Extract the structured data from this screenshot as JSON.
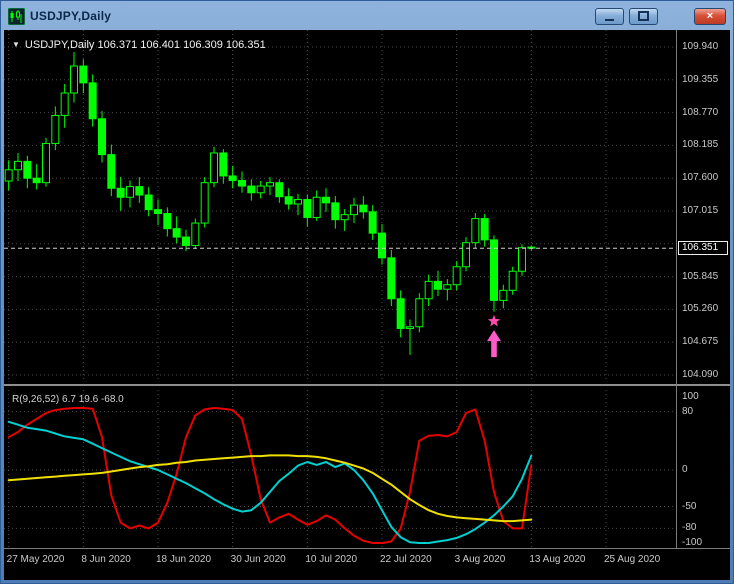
{
  "titlebar": {
    "title": "USDJPY,Daily",
    "close_glyph": "×"
  },
  "main_chart": {
    "marker_glyph": "▼",
    "ohlc_label": "USDJPY,Daily  106.371 106.401 106.309 106.351",
    "current_price": "106.351"
  },
  "indicator_panel": {
    "label": "R(9,26,52) 6.7 19.6 -68.0"
  },
  "colors": {
    "candle": "#00ff00",
    "grid": "#4a4a4a",
    "current_price_line": "#cfcfcf",
    "star": "#ff4dac",
    "arrow": "#ff5bc8",
    "osc_red": "#e60000",
    "osc_cyan": "#00d0d0",
    "osc_yellow": "#f0e000"
  },
  "chart_data": {
    "type": "candlestick+oscillator",
    "symbol": "USDJPY",
    "timeframe": "Daily",
    "price_grid": {
      "min": 104.09,
      "max": 109.94,
      "step": 0.585
    },
    "price_axis_labels": [
      "109.940",
      "109.355",
      "108.770",
      "108.185",
      "107.600",
      "107.015",
      "105.845",
      "105.260",
      "104.675",
      "104.090"
    ],
    "current_price": 106.351,
    "time_axis_labels": [
      "27 May 2020",
      "8 Jun 2020",
      "18 Jun 2020",
      "30 Jun 2020",
      "10 Jul 2020",
      "22 Jul 2020",
      "3 Aug 2020",
      "13 Aug 2020",
      "25 Aug 2020"
    ],
    "tick_every_candles": 8,
    "slots": 72,
    "candles_ohlc": [
      [
        107.55,
        107.92,
        107.38,
        107.75
      ],
      [
        107.75,
        108.05,
        107.55,
        107.9
      ],
      [
        107.9,
        108.0,
        107.42,
        107.6
      ],
      [
        107.6,
        107.85,
        107.4,
        107.52
      ],
      [
        107.52,
        108.32,
        107.45,
        108.22
      ],
      [
        108.22,
        108.88,
        108.1,
        108.72
      ],
      [
        108.72,
        109.28,
        108.5,
        109.12
      ],
      [
        109.12,
        109.85,
        108.95,
        109.6
      ],
      [
        109.6,
        109.72,
        109.12,
        109.3
      ],
      [
        109.3,
        109.45,
        108.52,
        108.66
      ],
      [
        108.66,
        108.8,
        107.88,
        108.02
      ],
      [
        108.02,
        108.2,
        107.28,
        107.42
      ],
      [
        107.42,
        107.62,
        107.02,
        107.26
      ],
      [
        107.26,
        107.56,
        107.08,
        107.45
      ],
      [
        107.45,
        107.62,
        107.16,
        107.3
      ],
      [
        107.3,
        107.44,
        106.92,
        107.04
      ],
      [
        107.04,
        107.22,
        106.76,
        106.97
      ],
      [
        106.97,
        107.08,
        106.56,
        106.7
      ],
      [
        106.7,
        106.92,
        106.44,
        106.55
      ],
      [
        106.55,
        106.68,
        106.3,
        106.4
      ],
      [
        106.4,
        106.88,
        106.34,
        106.8
      ],
      [
        106.8,
        107.62,
        106.72,
        107.52
      ],
      [
        107.52,
        108.16,
        107.44,
        108.05
      ],
      [
        108.05,
        108.12,
        107.5,
        107.64
      ],
      [
        107.64,
        107.82,
        107.42,
        107.56
      ],
      [
        107.56,
        107.72,
        107.34,
        107.46
      ],
      [
        107.46,
        107.58,
        107.2,
        107.34
      ],
      [
        107.34,
        107.55,
        107.24,
        107.46
      ],
      [
        107.46,
        107.62,
        107.3,
        107.52
      ],
      [
        107.52,
        107.58,
        107.16,
        107.27
      ],
      [
        107.27,
        107.42,
        107.04,
        107.14
      ],
      [
        107.14,
        107.32,
        106.94,
        107.22
      ],
      [
        107.22,
        107.3,
        106.74,
        106.9
      ],
      [
        106.9,
        107.38,
        106.84,
        107.26
      ],
      [
        107.26,
        107.42,
        107.0,
        107.16
      ],
      [
        107.16,
        107.28,
        106.7,
        106.86
      ],
      [
        106.86,
        107.05,
        106.66,
        106.95
      ],
      [
        106.95,
        107.25,
        106.8,
        107.12
      ],
      [
        107.12,
        107.28,
        106.88,
        107.0
      ],
      [
        107.0,
        107.12,
        106.5,
        106.62
      ],
      [
        106.62,
        106.78,
        106.06,
        106.18
      ],
      [
        106.18,
        106.32,
        105.32,
        105.45
      ],
      [
        105.45,
        105.6,
        104.76,
        104.92
      ],
      [
        104.92,
        105.08,
        104.45,
        104.95
      ],
      [
        104.95,
        105.55,
        104.85,
        105.45
      ],
      [
        105.45,
        105.88,
        105.32,
        105.76
      ],
      [
        105.76,
        105.95,
        105.5,
        105.62
      ],
      [
        105.62,
        105.8,
        105.42,
        105.7
      ],
      [
        105.7,
        106.12,
        105.6,
        106.02
      ],
      [
        106.02,
        106.55,
        105.94,
        106.45
      ],
      [
        106.45,
        106.98,
        106.36,
        106.88
      ],
      [
        106.88,
        106.96,
        106.38,
        106.5
      ],
      [
        106.5,
        106.58,
        105.22,
        105.42
      ],
      [
        105.42,
        105.7,
        105.28,
        105.6
      ],
      [
        105.6,
        106.02,
        105.52,
        105.94
      ],
      [
        105.94,
        106.42,
        105.86,
        106.36
      ],
      [
        106.371,
        106.401,
        106.309,
        106.351
      ]
    ],
    "marker": {
      "type": "star+up-arrow",
      "candle_index": 52,
      "price": 105.05
    },
    "oscillator": {
      "label": "R(9,26,52) 6.7 19.6 -68.0",
      "range": [
        -100,
        100
      ],
      "levels": [
        80,
        0,
        -50,
        -80
      ],
      "axis_labels": [
        100,
        80,
        0,
        -50,
        -80,
        -100
      ],
      "series": [
        {
          "name": "red",
          "values": [
            45,
            52,
            62,
            70,
            78,
            82,
            84,
            85,
            85,
            84,
            45,
            -35,
            -72,
            -80,
            -76,
            -80,
            -72,
            -45,
            -5,
            45,
            75,
            83,
            85,
            84,
            82,
            70,
            20,
            -40,
            -72,
            -65,
            -60,
            -68,
            -75,
            -70,
            -62,
            -68,
            -80,
            -90,
            -97,
            -100,
            -100,
            -98,
            -80,
            -30,
            40,
            47,
            48,
            46,
            52,
            78,
            83,
            40,
            -30,
            -70,
            -80,
            -80,
            6.7
          ]
        },
        {
          "name": "cyan",
          "values": [
            66,
            62,
            58,
            56,
            54,
            50,
            46,
            44,
            42,
            36,
            30,
            24,
            18,
            12,
            8,
            4,
            0,
            -6,
            -12,
            -18,
            -25,
            -32,
            -40,
            -47,
            -53,
            -57,
            -55,
            -45,
            -30,
            -15,
            -5,
            6,
            11,
            7,
            11,
            4,
            9,
            0,
            -14,
            -32,
            -55,
            -78,
            -92,
            -99,
            -100,
            -100,
            -98,
            -96,
            -93,
            -88,
            -81,
            -72,
            -62,
            -50,
            -36,
            -12,
            19.6
          ]
        },
        {
          "name": "yellow",
          "values": [
            -14,
            -13,
            -12,
            -11,
            -10,
            -9,
            -8,
            -7,
            -6,
            -5,
            -4,
            -2,
            0,
            2,
            4,
            5,
            7,
            8,
            10,
            11,
            13,
            14,
            15,
            16,
            17,
            18,
            19,
            19,
            20,
            20,
            20,
            19,
            19,
            18,
            16,
            13,
            10,
            6,
            2,
            -4,
            -12,
            -20,
            -30,
            -40,
            -48,
            -55,
            -60,
            -63,
            -65,
            -66,
            -67,
            -68,
            -69,
            -70,
            -70,
            -69,
            -68
          ]
        }
      ]
    }
  }
}
